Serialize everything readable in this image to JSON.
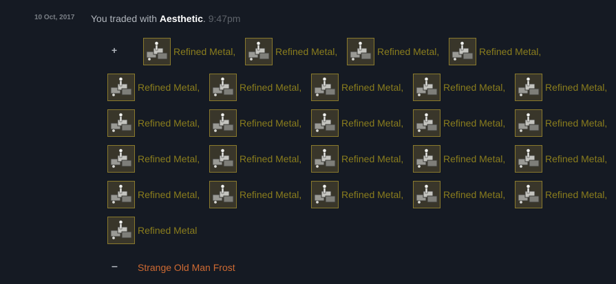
{
  "trade": {
    "date": "10 Oct, 2017",
    "prefix": "You traded with ",
    "partner": "Aesthetic",
    "suffix": ". ",
    "time": "9:47pm"
  },
  "given": {
    "sign": "+",
    "items": [
      {
        "name": "Refined Metal,"
      },
      {
        "name": "Refined Metal,"
      },
      {
        "name": "Refined Metal,"
      },
      {
        "name": "Refined Metal,"
      },
      {
        "name": "Refined Metal,"
      },
      {
        "name": "Refined Metal,"
      },
      {
        "name": "Refined Metal,"
      },
      {
        "name": "Refined Metal,"
      },
      {
        "name": "Refined Metal,"
      },
      {
        "name": "Refined Metal,"
      },
      {
        "name": "Refined Metal,"
      },
      {
        "name": "Refined Metal,"
      },
      {
        "name": "Refined Metal,"
      },
      {
        "name": "Refined Metal,"
      },
      {
        "name": "Refined Metal,"
      },
      {
        "name": "Refined Metal,"
      },
      {
        "name": "Refined Metal,"
      },
      {
        "name": "Refined Metal,"
      },
      {
        "name": "Refined Metal,"
      },
      {
        "name": "Refined Metal,"
      },
      {
        "name": "Refined Metal,"
      },
      {
        "name": "Refined Metal,"
      },
      {
        "name": "Refined Metal,"
      },
      {
        "name": "Refined Metal,"
      },
      {
        "name": "Refined Metal"
      }
    ],
    "item_icon": "refined-metal-icon",
    "item_color": "#8a7d1d",
    "border_color": "#8a7a2d"
  },
  "received": {
    "sign": "–",
    "item": "Strange Old Man Frost",
    "item_color": "#cf6a32"
  }
}
